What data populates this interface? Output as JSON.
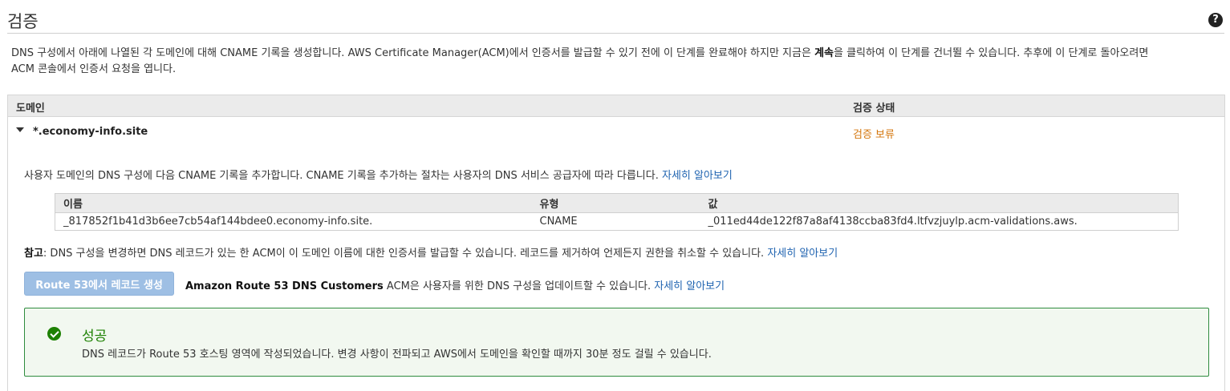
{
  "header": {
    "title": "검증",
    "help_icon": "?"
  },
  "intro": {
    "line1_before": "DNS 구성에서 아래에 나열된 각 도메인에 대해 CNAME 기록을 생성합니다. AWS Certificate Manager(ACM)에서 인증서를 발급할 수 있기 전에 이 단계를 완료해야 하지만 지금은 ",
    "line1_bold": "계속",
    "line1_after": "을 클릭하여 이 단계를 건너뛸 수 있습니다. 추후에 이 단계로 돌아오려면",
    "line2": "ACM 콘솔에서 인증서 요청을 엽니다."
  },
  "table": {
    "col_domain": "도메인",
    "col_status": "검증 상태"
  },
  "domain": {
    "name": "*.economy-info.site",
    "status": "검증 보류",
    "description": "사용자 도메인의 DNS 구성에 다음 CNAME 기록을 추가합니다. CNAME 기록을 추가하는 절차는 사용자의 DNS 서비스 공급자에 따라 다릅니다. ",
    "learn_more": "자세히 알아보기"
  },
  "records": {
    "headers": [
      "이름",
      "유형",
      "값"
    ],
    "rows": [
      {
        "name": "_817852f1b41d3b6ee7cb54af144bdee0.economy-info.site.",
        "type": "CNAME",
        "value": "_011ed44de122f87a8af4138ccba83fd4.ltfvzjuylp.acm-validations.aws."
      }
    ]
  },
  "note": {
    "label": "참고",
    "text": ": DNS 구성을 변경하면 DNS 레코드가 있는 한 ACM이 이 도메인 이름에 대한 인증서를 발급할 수 있습니다. 레코드를 제거하여 언제든지 권한을 취소할 수 있습니다. ",
    "learn_more": "자세히 알아보기"
  },
  "route53": {
    "button_label": "Route 53에서 레코드 생성",
    "bold": "Amazon Route 53 DNS Customers",
    "text": " ACM은 사용자를 위한 DNS 구성을 업데이트할 수 있습니다. ",
    "learn_more": "자세히 알아보기"
  },
  "success": {
    "title": "성공",
    "message": "DNS 레코드가 Route 53 호스팅 영역에 작성되었습니다. 변경 사항이 전파되고 AWS에서 도메인을 확인할 때까지 30분 정도 걸릴 수 있습니다."
  },
  "colors": {
    "pending": "#d4760c",
    "link": "#1f63b0",
    "success": "#1d8102",
    "button": "#9ebfe4"
  }
}
